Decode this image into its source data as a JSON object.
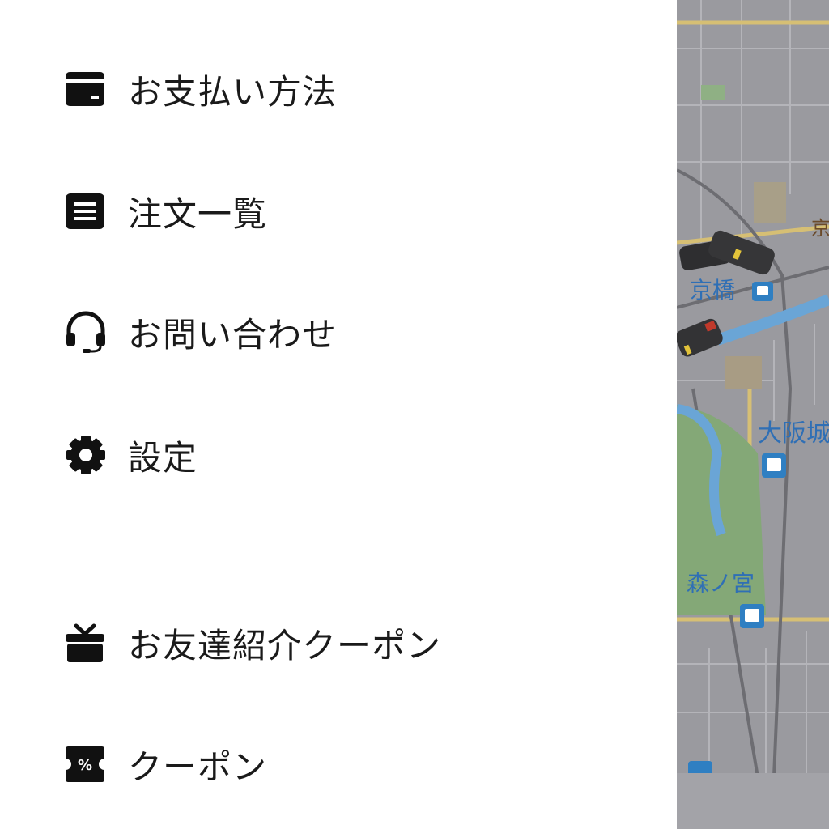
{
  "menu": {
    "items": [
      {
        "label": "お支払い方法",
        "icon": "credit-card-icon"
      },
      {
        "label": "注文一覧",
        "icon": "receipt-list-icon"
      },
      {
        "label": "お問い合わせ",
        "icon": "headset-icon"
      },
      {
        "label": "設定",
        "icon": "gear-icon"
      },
      {
        "label": "お友達紹介クーポン",
        "icon": "gift-icon"
      },
      {
        "label": "クーポン",
        "icon": "coupon-ticket-icon"
      }
    ]
  },
  "map": {
    "labels": {
      "kyobashi": "京橋",
      "osakajo": "大阪城",
      "morinomiya": "森ノ宮",
      "edge": "京"
    },
    "colors": {
      "base": "#9a9a9f",
      "road": "#bdbdc2",
      "major_road": "#d8c27a",
      "river": "#6fa8dc",
      "park": "#7fa36f",
      "label": "#2f6fb5"
    }
  },
  "coupon_icon_text": "%"
}
